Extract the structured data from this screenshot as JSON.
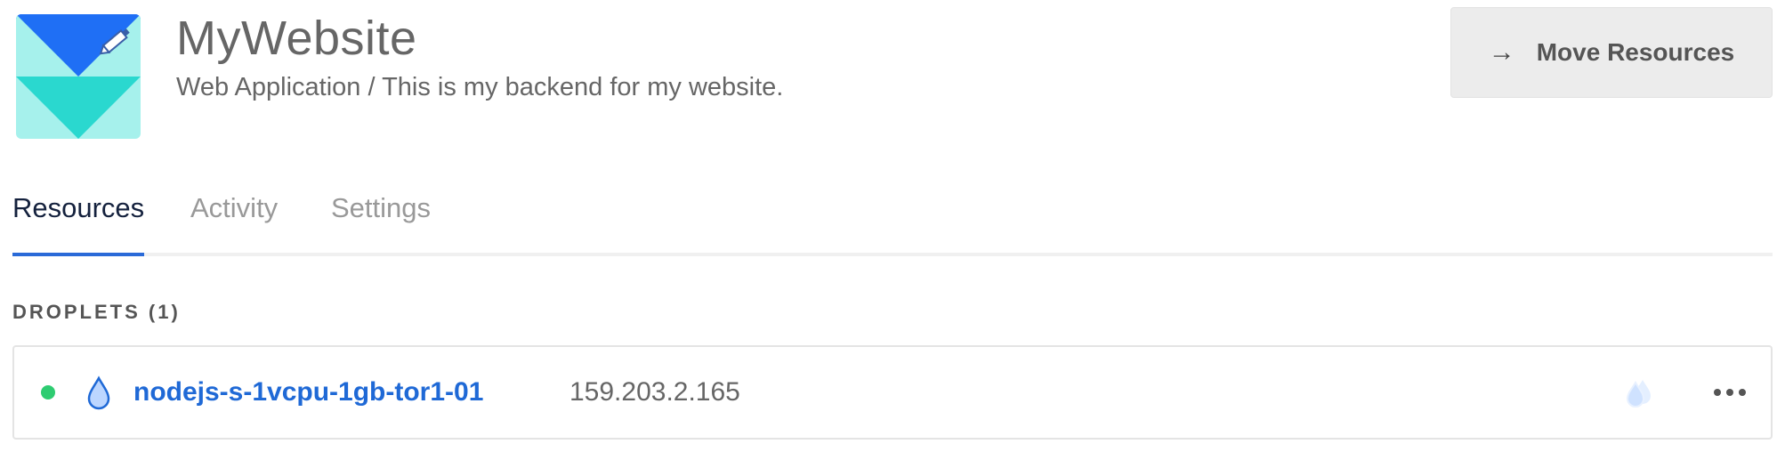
{
  "project": {
    "name": "MyWebsite",
    "subtitle": "Web Application / This is my backend for my website.",
    "icon": "project-envelope-icon",
    "colors": {
      "primary": "#1f6ff5",
      "teal": "#2ad8cf",
      "mint": "#a6f1ec"
    }
  },
  "header": {
    "move_button": {
      "icon": "arrow-right-icon",
      "arrow": "→",
      "label": "Move Resources"
    }
  },
  "tabs": [
    {
      "label": "Resources",
      "active": true
    },
    {
      "label": "Activity",
      "active": false
    },
    {
      "label": "Settings",
      "active": false
    }
  ],
  "section": {
    "label": "DROPLETS (1)"
  },
  "droplets": [
    {
      "status": "active",
      "status_color": "#2ecc71",
      "name": "nodejs-s-1vcpu-1gb-tor1-01",
      "ip": "159.203.2.165",
      "icons": [
        "droplet-icon",
        "backups-icon",
        "more-options-icon"
      ]
    }
  ]
}
